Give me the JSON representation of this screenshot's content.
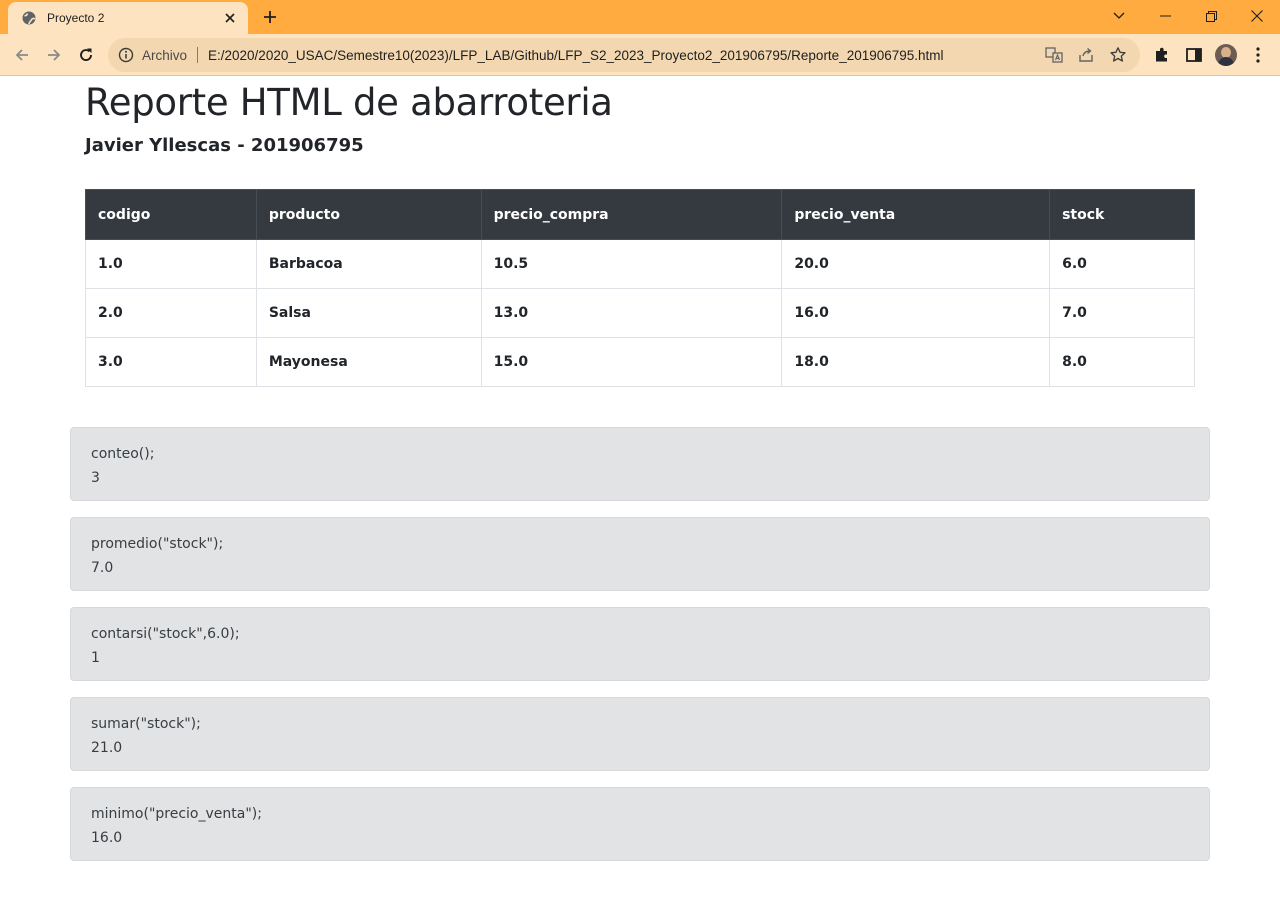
{
  "browser": {
    "tab_title": "Proyecto 2",
    "scheme_label": "Archivo",
    "url": "E:/2020/2020_USAC/Semestre10(2023)/LFP_LAB/Github/LFP_S2_2023_Proyecto2_201906795/Reporte_201906795.html",
    "accent_color": "#ffab40"
  },
  "page": {
    "title": "Reporte HTML de abarroteria",
    "subtitle": "Javier Yllescas - 201906795"
  },
  "table": {
    "headers": [
      "codigo",
      "producto",
      "precio_compra",
      "precio_venta",
      "stock"
    ],
    "rows": [
      [
        "1.0",
        "Barbacoa",
        "10.5",
        "20.0",
        "6.0"
      ],
      [
        "2.0",
        "Salsa",
        "13.0",
        "16.0",
        "7.0"
      ],
      [
        "3.0",
        "Mayonesa",
        "15.0",
        "18.0",
        "8.0"
      ]
    ]
  },
  "results": [
    {
      "expr": "conteo();",
      "value": "3"
    },
    {
      "expr": "promedio(\"stock\");",
      "value": "7.0"
    },
    {
      "expr": "contarsi(\"stock\",6.0);",
      "value": "1"
    },
    {
      "expr": "sumar(\"stock\");",
      "value": "21.0"
    },
    {
      "expr": "minimo(\"precio_venta\");",
      "value": "16.0"
    }
  ]
}
